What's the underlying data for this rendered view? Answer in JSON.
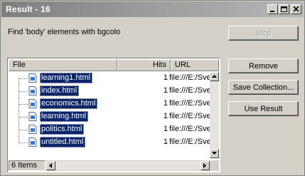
{
  "window": {
    "title": "Result - 16"
  },
  "description": "Find 'body' elements with bgcolo",
  "buttons": {
    "stop": "Stop",
    "remove": "Remove",
    "save_collection": "Save Collection...",
    "use_result": "Use Result"
  },
  "table": {
    "columns": [
      "File",
      "Hits",
      "URL"
    ],
    "rows": [
      {
        "file": "learning1.html",
        "hits": "1",
        "url": "file:///E:/Sve"
      },
      {
        "file": "index.html",
        "hits": "1",
        "url": "file:///E:/Sve"
      },
      {
        "file": "economics.html",
        "hits": "1",
        "url": "file:///E:/Sve"
      },
      {
        "file": "learning.html",
        "hits": "1",
        "url": "file:///E:/Sve"
      },
      {
        "file": "politics.html",
        "hits": "1",
        "url": "file:///E:/Sve"
      },
      {
        "file": "untitled.html",
        "hits": "1",
        "url": "file:///E:/Sve"
      }
    ]
  },
  "status": {
    "items": "6 Items"
  },
  "icons": {
    "minimize": "minimize-icon",
    "maximize": "maximize-icon",
    "close": "close-icon",
    "file": "html-file-icon"
  },
  "colors": {
    "selection": "#0a246a",
    "title_bar": "#808080"
  }
}
